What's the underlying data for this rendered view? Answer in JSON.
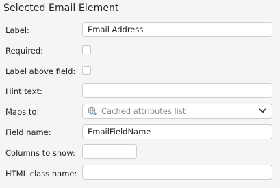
{
  "panel": {
    "title": "Selected Email Element"
  },
  "fields": {
    "label": {
      "label": "Label:",
      "value": "Email Address"
    },
    "required": {
      "label": "Required:",
      "checked": false
    },
    "label_above": {
      "label": "Label above field:",
      "checked": false
    },
    "hint_text": {
      "label": "Hint text:",
      "value": ""
    },
    "maps_to": {
      "label": "Maps to:",
      "placeholder": "Cached attributes list",
      "icon": "globe-icon",
      "dropdown_icon": "chevron-down-icon"
    },
    "field_name": {
      "label": "Field name:",
      "value": "EmailFieldName"
    },
    "columns": {
      "label": "Columns to show:",
      "value": ""
    },
    "html_class": {
      "label": "HTML class name:",
      "value": ""
    }
  }
}
